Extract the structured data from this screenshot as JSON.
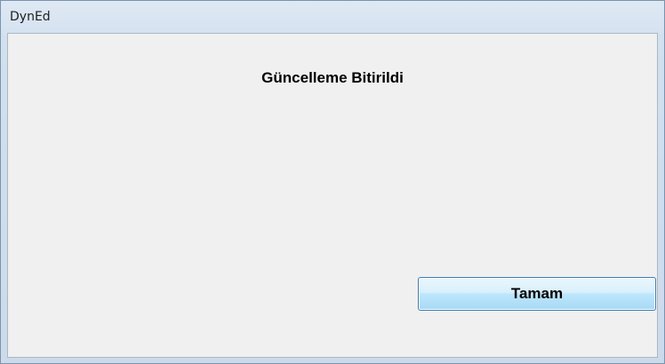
{
  "window": {
    "title": "DynEd"
  },
  "dialog": {
    "message": "Güncelleme Bitirildi",
    "ok_label": "Tamam"
  },
  "colors": {
    "client_background": "#f0f0f0",
    "button_border": "#3c7fb1",
    "title_bar": "#d5e2f0"
  }
}
